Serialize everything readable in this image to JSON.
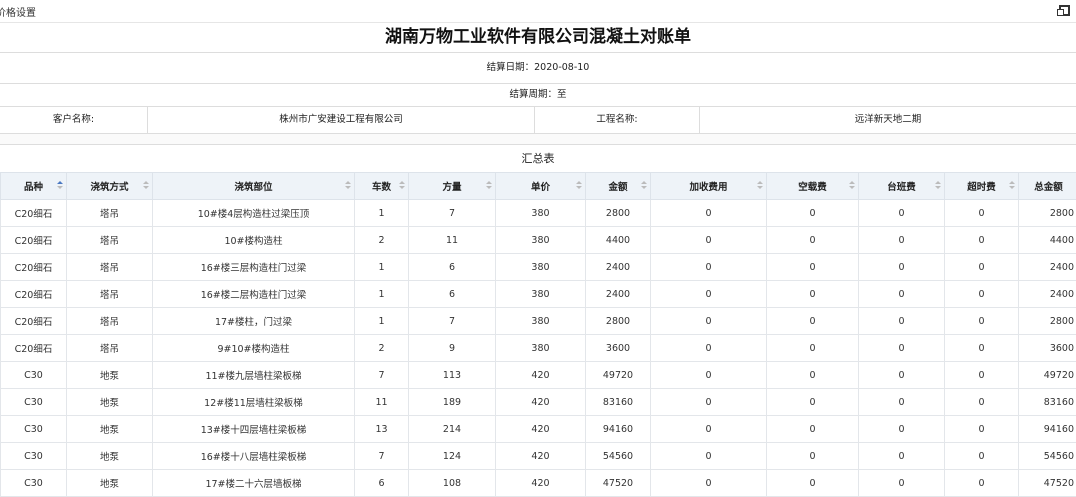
{
  "window": {
    "title": "价格设置"
  },
  "document": {
    "title": "湖南万物工业软件有限公司混凝土对账单",
    "settle_date": "结算日期：2020-08-10",
    "settle_period": "结算周期：至",
    "customer_label": "客户名称:",
    "customer_value": "株州市广安建设工程有限公司",
    "project_label": "工程名称:",
    "project_value": "远洋新天地二期",
    "summary_title": "汇总表"
  },
  "table": {
    "columns": [
      "品种",
      "浇筑方式",
      "浇筑部位",
      "车数",
      "方量",
      "单价",
      "金额",
      "加收费用",
      "空载费",
      "台班费",
      "超时费",
      "总金额"
    ],
    "rows": [
      [
        "C20细石",
        "塔吊",
        "10#楼4层构造柱过梁压顶",
        "1",
        "7",
        "380",
        "2800",
        "0",
        "0",
        "0",
        "0",
        "2800"
      ],
      [
        "C20细石",
        "塔吊",
        "10#楼构造柱",
        "2",
        "11",
        "380",
        "4400",
        "0",
        "0",
        "0",
        "0",
        "4400"
      ],
      [
        "C20细石",
        "塔吊",
        "16#楼三层构造柱门过梁",
        "1",
        "6",
        "380",
        "2400",
        "0",
        "0",
        "0",
        "0",
        "2400"
      ],
      [
        "C20细石",
        "塔吊",
        "16#楼二层构造柱门过梁",
        "1",
        "6",
        "380",
        "2400",
        "0",
        "0",
        "0",
        "0",
        "2400"
      ],
      [
        "C20细石",
        "塔吊",
        "17#楼柱，门过梁",
        "1",
        "7",
        "380",
        "2800",
        "0",
        "0",
        "0",
        "0",
        "2800"
      ],
      [
        "C20细石",
        "塔吊",
        "9#10#楼构造柱",
        "2",
        "9",
        "380",
        "3600",
        "0",
        "0",
        "0",
        "0",
        "3600"
      ],
      [
        "C30",
        "地泵",
        "11#楼九层墙柱梁板梯",
        "7",
        "113",
        "420",
        "49720",
        "0",
        "0",
        "0",
        "0",
        "49720"
      ],
      [
        "C30",
        "地泵",
        "12#楼11层墙柱梁板梯",
        "11",
        "189",
        "420",
        "83160",
        "0",
        "0",
        "0",
        "0",
        "83160"
      ],
      [
        "C30",
        "地泵",
        "13#楼十四层墙柱梁板梯",
        "13",
        "214",
        "420",
        "94160",
        "0",
        "0",
        "0",
        "0",
        "94160"
      ],
      [
        "C30",
        "地泵",
        "16#楼十八层墙柱梁板梯",
        "7",
        "124",
        "420",
        "54560",
        "0",
        "0",
        "0",
        "0",
        "54560"
      ],
      [
        "C30",
        "地泵",
        "17#楼二十六层墙板梯",
        "6",
        "108",
        "420",
        "47520",
        "0",
        "0",
        "0",
        "0",
        "47520"
      ]
    ]
  },
  "icons": {
    "restore": "window-restore-icon",
    "sort": "sort-icon"
  }
}
